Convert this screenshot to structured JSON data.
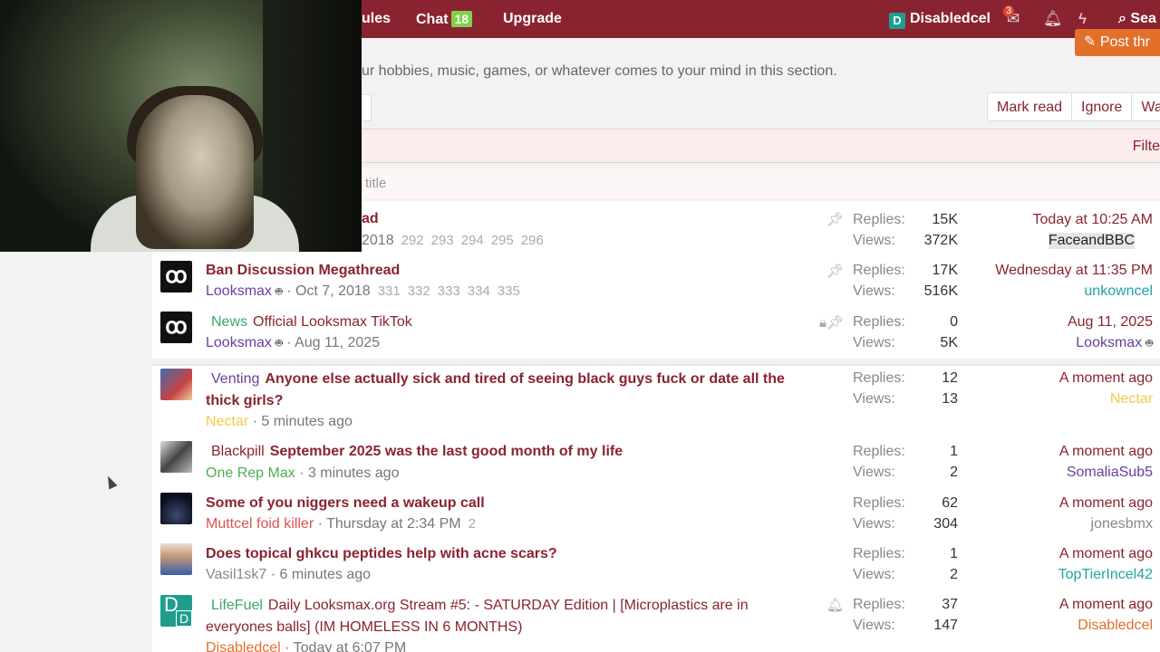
{
  "topnav": {
    "rules": "ules",
    "chat": "Chat",
    "chat_count": "18",
    "upgrade": "Upgrade",
    "user_letter": "D",
    "username": "Disabledcel",
    "inbox_count": "3",
    "search": "Sea"
  },
  "post_thread": "Post thr",
  "description": "ur hobbies, music, games, or whatever comes to your mind in this section.",
  "actions": [
    "Mark read",
    "Ignore",
    "Wa"
  ],
  "filters": "Filte",
  "title_filter_placeholder": "title",
  "sticky_threads": [
    {
      "title": "ad",
      "prefix": "",
      "author": "",
      "date": "2018",
      "pages": [
        "292",
        "293",
        "294",
        "295",
        "296"
      ],
      "replies": "15K",
      "views": "372K",
      "last_date": "Today at 10:25 AM",
      "last_user": "FaceandBBC"
    },
    {
      "title": "Ban Discussion Megathread",
      "prefix": "",
      "author": "Looksmax",
      "date": "Oct 7, 2018",
      "pages": [
        "331",
        "332",
        "333",
        "334",
        "335"
      ],
      "replies": "17K",
      "views": "516K",
      "last_date": "Wednesday at 11:35 PM",
      "last_user": "unkowncel"
    },
    {
      "title": "Official Looksmax TikTok",
      "prefix": "News",
      "author": "Looksmax",
      "date": "Aug 11, 2025",
      "pages": [],
      "replies": "0",
      "views": "5K",
      "last_date": "Aug 11, 2025",
      "last_user": "Looksmax"
    }
  ],
  "threads": [
    {
      "prefix": "Venting",
      "title": "Anyone else actually sick and tired of seeing black guys fuck or date all the",
      "title2": "thick girls?",
      "author": "Nectar",
      "date": "5 minutes ago",
      "replies": "12",
      "views": "13",
      "last_date": "A moment ago",
      "last_user": "Nectar"
    },
    {
      "prefix": "Blackpill",
      "title": "September 2025 was the last good month of my life",
      "author": "One Rep Max",
      "date": "3 minutes ago",
      "replies": "1",
      "views": "2",
      "last_date": "A moment ago",
      "last_user": "SomaliaSub5"
    },
    {
      "prefix": "",
      "title": "Some of you niggers need a wakeup call",
      "author": "Muttcel foid killer",
      "date": "Thursday at 2:34 PM",
      "page": "2",
      "replies": "62",
      "views": "304",
      "last_date": "A moment ago",
      "last_user": "jonesbmx"
    },
    {
      "prefix": "",
      "title": "Does topical ghkcu peptides help with acne scars?",
      "author": "Vasil1sk7",
      "date": "6 minutes ago",
      "replies": "1",
      "views": "2",
      "last_date": "A moment ago",
      "last_user": "TopTierIncel42"
    },
    {
      "prefix": "LifeFuel",
      "title": "Daily Looksmax.org Stream #5: - SATURDAY Edition | [Microplastics are in",
      "title2": "everyones balls] (IM HOMELESS IN 6 MONTHS)",
      "author": "Disabledcel",
      "date": "Today at 6:07 PM",
      "replies": "37",
      "views": "147",
      "last_date": "A moment ago",
      "last_user": "Disabledcel"
    }
  ],
  "labels": {
    "replies": "Replies:",
    "views": "Views:",
    "sep": "·",
    "logo": "ꝏ",
    "avatar_letter": "D"
  },
  "colors": {
    "nav_bg": "#8a2330",
    "accent": "#8a2330",
    "prefix_green": "#3aa86b",
    "author_purple": "#6a3fa0",
    "author_green": "#4caf50",
    "author_red": "#d9534f",
    "author_orange": "#e3702a",
    "author_teal": "#22a3a3",
    "author_gold": "#f2c94c"
  }
}
